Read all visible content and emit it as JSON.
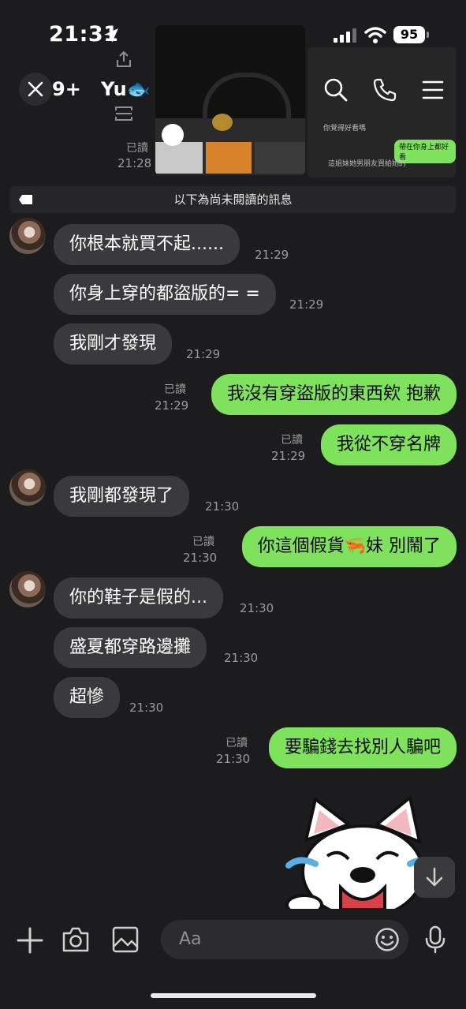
{
  "status_bar": {
    "time": "21:31",
    "battery": "95"
  },
  "header": {
    "unread_count": "9+",
    "contact_name": "Yu🐟"
  },
  "previous": {
    "read_label": "已讀",
    "time": "21:28"
  },
  "preview_texts": [
    "你覺得好看嗎",
    "帶在你身上都好看",
    "這姐妹她男朋友買給她的"
  ],
  "divider": {
    "text": "以下為尚未閱讀的訊息"
  },
  "messages": [
    {
      "dir": "in",
      "text": "你根本就買不起......",
      "time": "21:29"
    },
    {
      "dir": "in",
      "text": "你身上穿的都盜版的= =",
      "time": "21:29"
    },
    {
      "dir": "in",
      "text": "我剛才發現",
      "time": "21:29"
    },
    {
      "dir": "out",
      "text": "我沒有穿盜版的東西欸 抱歉",
      "read": "已讀",
      "time": "21:29"
    },
    {
      "dir": "out",
      "text": "我從不穿名牌",
      "read": "已讀",
      "time": "21:29"
    },
    {
      "dir": "in",
      "text": "我剛都發現了",
      "time": "21:30"
    },
    {
      "dir": "out",
      "text": "你這個假貨🦐妹 別鬧了",
      "read": "已讀",
      "time": "21:30"
    },
    {
      "dir": "in",
      "text": "你的鞋子是假的...",
      "time": "21:30"
    },
    {
      "dir": "in",
      "text": "盛夏都穿路邊攤",
      "time": "21:30"
    },
    {
      "dir": "in",
      "text": "超慘",
      "time": "21:30"
    },
    {
      "dir": "out",
      "text": "要騙錢去找別人騙吧",
      "read": "已讀",
      "time": "21:30"
    }
  ],
  "input": {
    "placeholder": "Aa"
  },
  "icons": {
    "close": "close-icon",
    "search": "search-icon",
    "call": "phone-icon",
    "menu": "menu-icon",
    "add": "plus-icon",
    "camera": "camera-icon",
    "gallery": "image-icon",
    "emoji": "emoji-icon",
    "mic": "mic-icon",
    "scroll": "arrow-down-icon",
    "sticker": "bulldog-sticker"
  },
  "colors": {
    "outgoing_bubble": "#7ee25d",
    "incoming_bubble": "#3a3a3c",
    "background": "#1c1c1e"
  }
}
